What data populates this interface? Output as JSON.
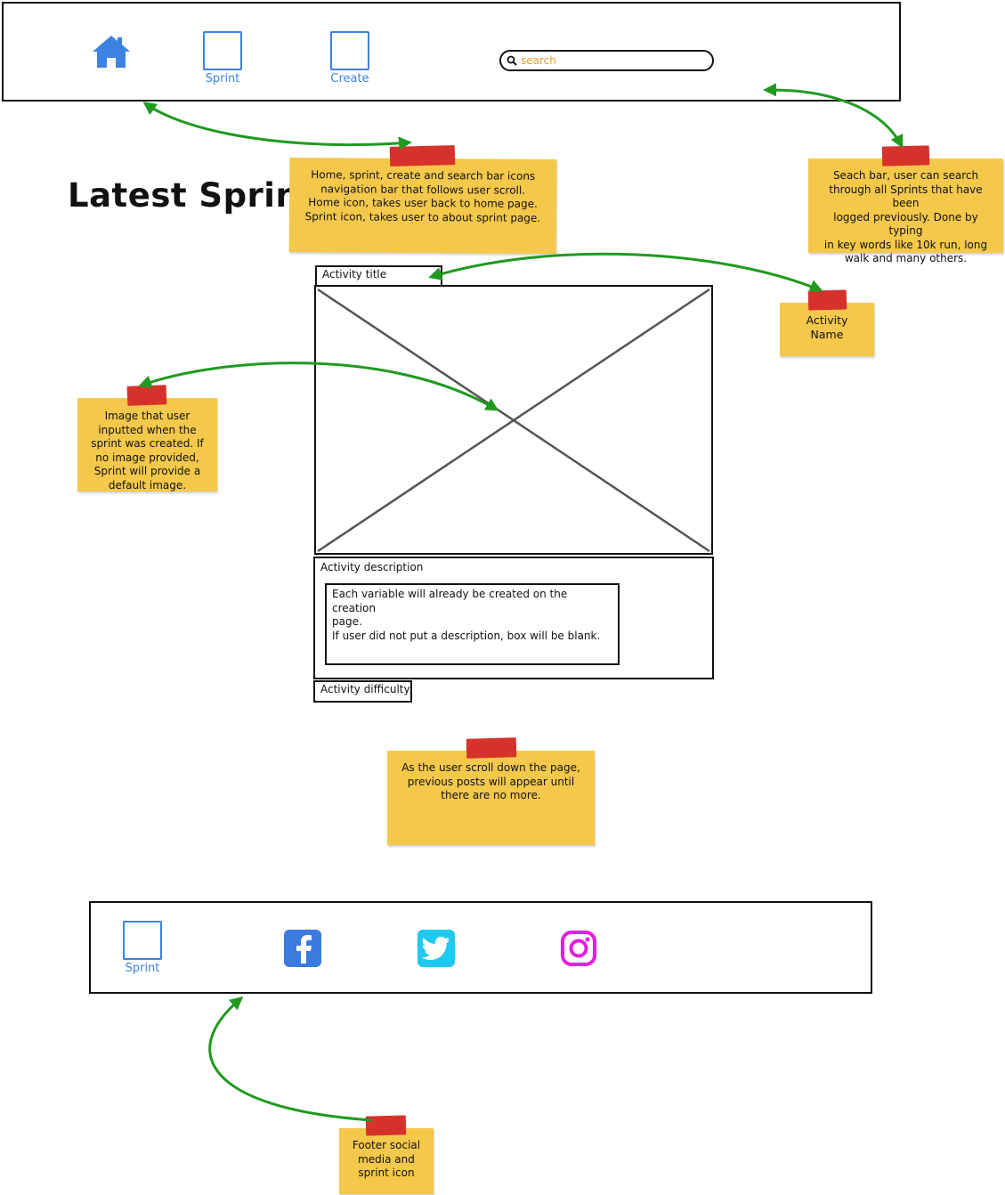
{
  "navbar": {
    "items": [
      {
        "icon": "home-icon",
        "label": ""
      },
      {
        "icon": "square-icon",
        "label": "Sprint"
      },
      {
        "icon": "square-icon",
        "label": "Create"
      }
    ],
    "search": {
      "placeholder": "search"
    }
  },
  "page": {
    "title": "Latest Sprint"
  },
  "activity": {
    "title": "Activity title",
    "description_label": "Activity description",
    "description_lines": [
      "Each variable will already be created on the creation",
      "page.",
      "If user did not put a description, box will be blank."
    ],
    "difficulty_label": "Activity difficulty"
  },
  "notes": {
    "navbar": [
      "Home, sprint, create and search bar icons",
      "navigation bar that follows user scroll.",
      "Home icon, takes user back to home page.",
      "Sprint icon, takes user to about sprint page."
    ],
    "search": [
      "Seach bar, user can search",
      "through all Sprints that have been",
      "logged previously. Done by typing",
      "in key words like 10k run, long",
      "walk and many others."
    ],
    "activity_name": [
      "Activity Name"
    ],
    "image": [
      "Image that user",
      "inputted when the",
      "sprint was created. If",
      "no image provided,",
      "Sprint will provide a",
      "default image."
    ],
    "scroll": [
      "As the user scroll down the page,",
      "previous posts will appear until",
      "there are no more."
    ],
    "footer": [
      "Footer social",
      "media and",
      "sprint icon"
    ]
  },
  "footer": {
    "sprint_label": "Sprint",
    "social_icons": [
      "facebook-icon",
      "twitter-icon",
      "instagram-icon"
    ]
  },
  "colors": {
    "link_blue": "#3c82e0",
    "note_yellow": "#f4c84a",
    "tape_red": "#d6322c",
    "arrow_green": "#1f9a1f",
    "search_placeholder": "#e8a02a",
    "facebook": "#3a7be0",
    "twitter": "#1fc8ef",
    "instagram": "#e51ee0"
  }
}
